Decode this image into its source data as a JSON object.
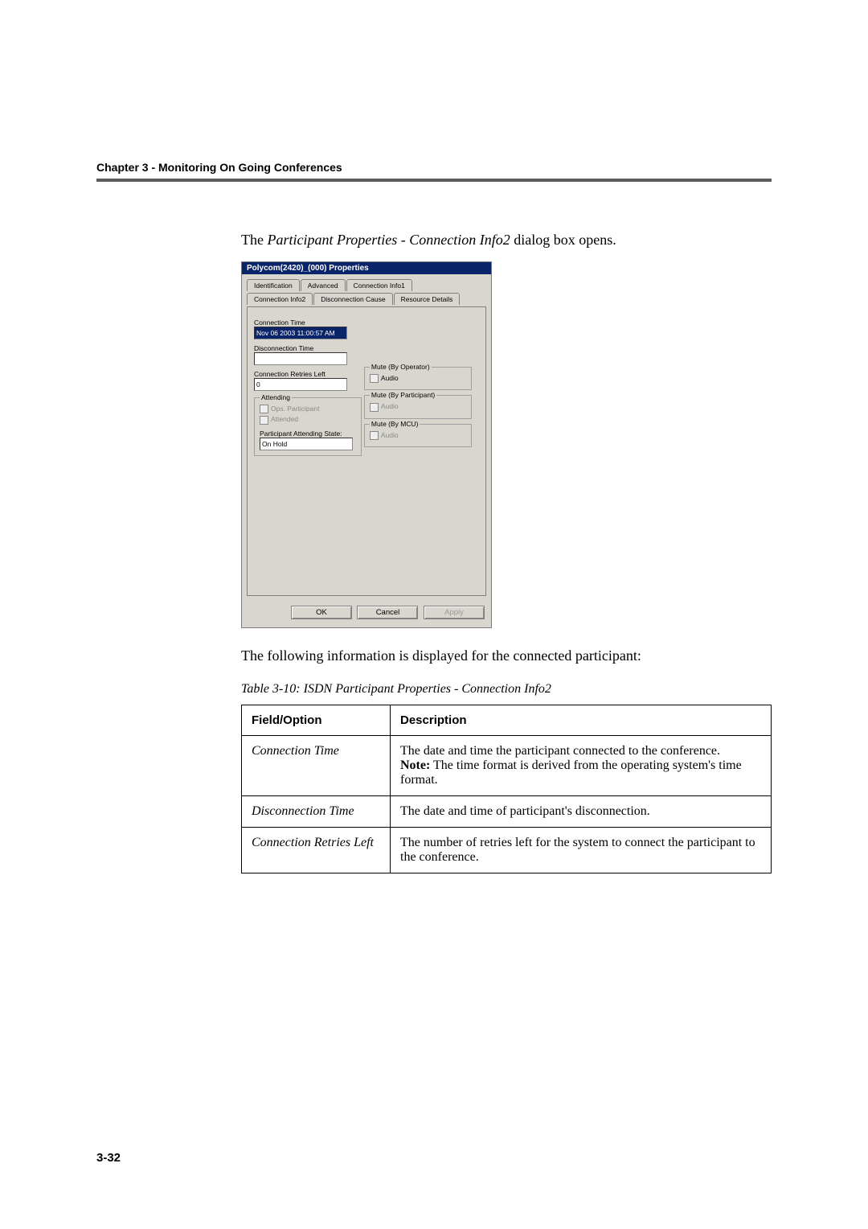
{
  "chapter_header": "Chapter 3 - Monitoring On Going Conferences",
  "intro_prefix": "The ",
  "intro_em": "Participant Properties - Connection Info2",
  "intro_suffix": " dialog box opens.",
  "after_figure": "The following information is displayed for the connected participant:",
  "table_caption": "Table 3-10: ISDN Participant Properties - Connection Info2",
  "dialog": {
    "title": "Polycom(2420)_(000) Properties",
    "tabs_row1": [
      "Identification",
      "Advanced",
      "Connection Info1"
    ],
    "tabs_row2": [
      "Connection Info2",
      "Disconnection Cause",
      "Resource Details"
    ],
    "conn_time_label": "Connection Time",
    "conn_time_value": "Nov 06 2003 11:00:57 AM",
    "disc_time_label": "Disconnection Time",
    "disc_time_value": "",
    "retries_label": "Connection Retries Left",
    "retries_value": "0",
    "attending_title": "Attending",
    "attending_cb1": "Ops. Participant",
    "attending_cb2": "Attended",
    "pas_label": "Participant Attending State:",
    "pas_value": "On Hold",
    "mute_op_title": "Mute (By Operator)",
    "mute_op_cb": "Audio",
    "mute_part_title": "Mute (By Participant)",
    "mute_part_cb": "Audio",
    "mute_mcu_title": "Mute (By MCU)",
    "mute_mcu_cb": "Audio",
    "btn_ok": "OK",
    "btn_cancel": "Cancel",
    "btn_apply": "Apply"
  },
  "table": {
    "h1": "Field/Option",
    "h2": "Description",
    "rows": [
      {
        "opt": "Connection Time",
        "desc_pre": "The date and time the participant connected to the conference.",
        "desc_note_label": "Note:",
        "desc_note_rest": " The time format is derived from the operating system's time format."
      },
      {
        "opt": "Disconnection Time",
        "desc": "The date and time of participant's disconnection."
      },
      {
        "opt": "Connection Retries Left",
        "desc": "The number of retries left for the system to connect the participant to the conference."
      }
    ]
  },
  "page_num": "3-32"
}
